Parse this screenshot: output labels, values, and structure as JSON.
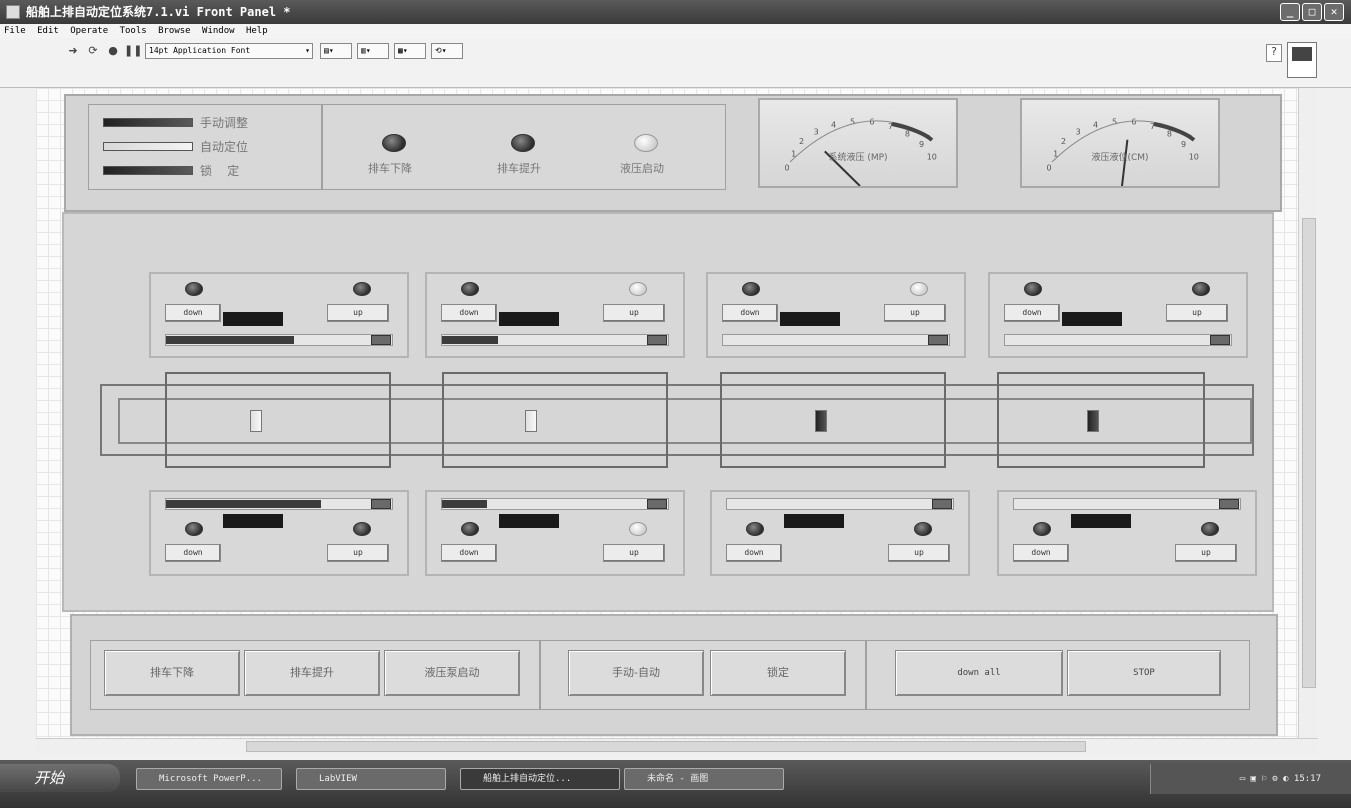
{
  "window": {
    "title": "船舶上排自动定位系统7.1.vi Front Panel *"
  },
  "menu": [
    "File",
    "Edit",
    "Operate",
    "Tools",
    "Browse",
    "Window",
    "Help"
  ],
  "toolbar": {
    "font": "14pt Application Font"
  },
  "status_panel": {
    "indicators": [
      {
        "label": "手动调整",
        "state": "dark"
      },
      {
        "label": "自动定位",
        "state": "light"
      },
      {
        "label": "锁    定",
        "state": "dark"
      }
    ],
    "leds": [
      {
        "label": "排车下降",
        "on": false
      },
      {
        "label": "排车提升",
        "on": false
      },
      {
        "label": "液压启动",
        "on": true
      }
    ]
  },
  "gauges": [
    {
      "label": "系统液压 (MP)",
      "ticks": [
        "0",
        "1",
        "2",
        "3",
        "4",
        "5",
        "6",
        "7",
        "8",
        "9",
        "10"
      ],
      "value": 2.4
    },
    {
      "label": "液压液位(CM)",
      "ticks": [
        "0",
        "1",
        "2",
        "3",
        "4",
        "5",
        "6",
        "7",
        "8",
        "9",
        "10"
      ],
      "value": 5.8
    }
  ],
  "top_controls": [
    {
      "down": "down",
      "up": "up",
      "led_left_on": false,
      "led_right_on": false,
      "fill": 0.62
    },
    {
      "down": "down",
      "up": "up",
      "led_left_on": false,
      "led_right_on": true,
      "fill": 0.27
    },
    {
      "down": "down",
      "up": "up",
      "led_left_on": false,
      "led_right_on": true,
      "fill": 0.0
    },
    {
      "down": "down",
      "up": "up",
      "led_left_on": false,
      "led_right_on": false,
      "fill": 0.0
    }
  ],
  "positions": [
    {
      "state": "light"
    },
    {
      "state": "light"
    },
    {
      "state": "dark"
    },
    {
      "state": "dark"
    }
  ],
  "bottom_controls": [
    {
      "down": "down",
      "up": "up",
      "led_left_on": false,
      "led_right_on": false,
      "fill": 0.75
    },
    {
      "down": "down",
      "up": "up",
      "led_left_on": false,
      "led_right_on": true,
      "fill": 0.22
    },
    {
      "down": "down",
      "up": "up",
      "led_left_on": false,
      "led_right_on": false,
      "fill": 0.0
    },
    {
      "down": "down",
      "up": "up",
      "led_left_on": false,
      "led_right_on": false,
      "fill": 0.0
    }
  ],
  "buttons": {
    "car_down": "排车下降",
    "car_up": "排车提升",
    "pump_start": "液压泵启动",
    "manual_auto": "手动-自动",
    "lock": "锁定",
    "down_all": "down all",
    "stop": "STOP"
  },
  "taskbar": {
    "start": "开始",
    "tasks": [
      "Microsoft PowerP...",
      "LabVIEW",
      "船舶上排自动定位...",
      "未命名 - 画图"
    ],
    "clock": "15:17"
  }
}
